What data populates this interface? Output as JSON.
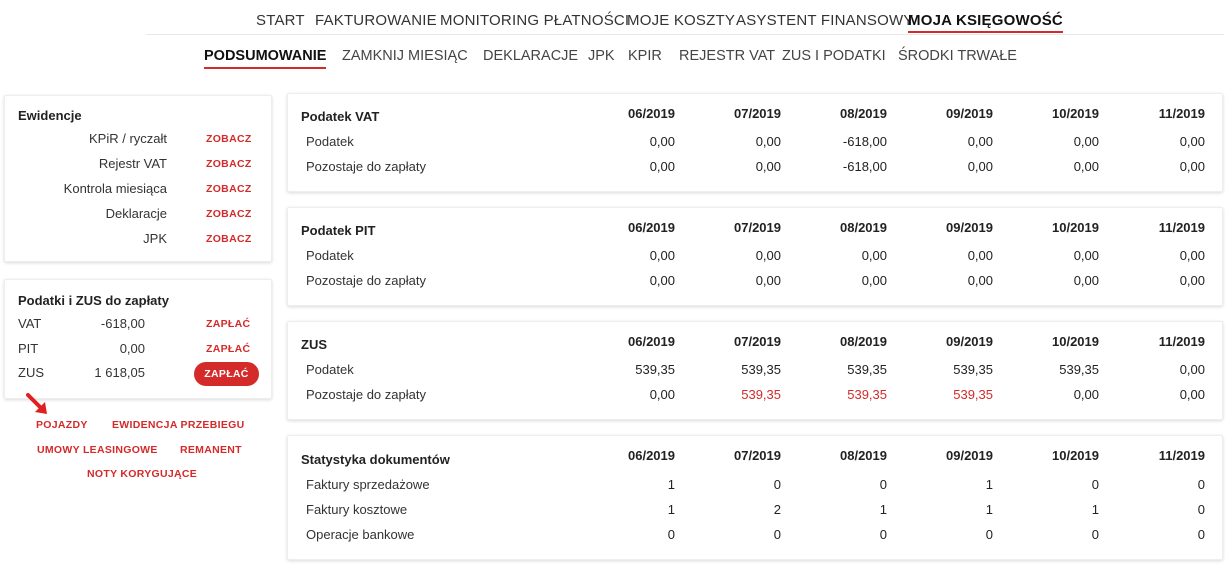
{
  "top_nav": {
    "items": [
      {
        "label": "START",
        "active": false
      },
      {
        "label": "FAKTUROWANIE",
        "active": false
      },
      {
        "label": "MONITORING PŁATNOŚCI",
        "active": false
      },
      {
        "label": "MOJE KOSZTY",
        "active": false
      },
      {
        "label": "ASYSTENT FINANSOWY",
        "active": false
      },
      {
        "label": "MOJA KSIĘGOWOŚĆ",
        "active": true
      }
    ]
  },
  "sub_nav": {
    "items": [
      {
        "label": "PODSUMOWANIE",
        "active": true
      },
      {
        "label": "ZAMKNIJ MIESIĄC",
        "active": false
      },
      {
        "label": "DEKLARACJE",
        "active": false
      },
      {
        "label": "JPK",
        "active": false
      },
      {
        "label": "KPIR",
        "active": false
      },
      {
        "label": "REJESTR VAT",
        "active": false
      },
      {
        "label": "ZUS I PODATKI",
        "active": false
      },
      {
        "label": "ŚRODKI TRWAŁE",
        "active": false
      }
    ]
  },
  "ewidencje": {
    "title": "Ewidencje",
    "rows": [
      {
        "label": "KPiR / ryczałt",
        "link": "ZOBACZ"
      },
      {
        "label": "Rejestr VAT",
        "link": "ZOBACZ"
      },
      {
        "label": "Kontrola miesiąca",
        "link": "ZOBACZ"
      },
      {
        "label": "Deklaracje",
        "link": "ZOBACZ"
      },
      {
        "label": "JPK",
        "link": "ZOBACZ"
      }
    ]
  },
  "podatki_zus": {
    "title": "Podatki i ZUS do zapłaty",
    "rows": [
      {
        "label": "VAT",
        "value": "-618,00",
        "action": "ZAPŁAĆ",
        "style": "link"
      },
      {
        "label": "PIT",
        "value": "0,00",
        "action": "ZAPŁAĆ",
        "style": "link"
      },
      {
        "label": "ZUS",
        "value": "1 618,05",
        "action": "ZAPŁAĆ",
        "style": "button"
      }
    ]
  },
  "extra_links": {
    "pojazdy": "POJAZDY",
    "ewidencja_przebiegu": "EWIDENCJA PRZEBIEGU",
    "umowy_leasingowe": "UMOWY LEASINGOWE",
    "remanent": "REMANENT",
    "noty_korygujace": "NOTY KORYGUJĄCE"
  },
  "colors": {
    "accent": "#d42a2a",
    "text": "#222222",
    "card_border": "#eeeeee"
  },
  "tables": [
    {
      "title": "Podatek VAT",
      "periods": [
        "06/2019",
        "07/2019",
        "08/2019",
        "09/2019",
        "10/2019",
        "11/2019"
      ],
      "rows": [
        {
          "label": "Podatek",
          "values": [
            "0,00",
            "0,00",
            "-618,00",
            "0,00",
            "0,00",
            "0,00"
          ],
          "red": [
            false,
            false,
            false,
            false,
            false,
            false
          ]
        },
        {
          "label": "Pozostaje do zapłaty",
          "values": [
            "0,00",
            "0,00",
            "-618,00",
            "0,00",
            "0,00",
            "0,00"
          ],
          "red": [
            false,
            false,
            false,
            false,
            false,
            false
          ]
        }
      ]
    },
    {
      "title": "Podatek PIT",
      "periods": [
        "06/2019",
        "07/2019",
        "08/2019",
        "09/2019",
        "10/2019",
        "11/2019"
      ],
      "rows": [
        {
          "label": "Podatek",
          "values": [
            "0,00",
            "0,00",
            "0,00",
            "0,00",
            "0,00",
            "0,00"
          ],
          "red": [
            false,
            false,
            false,
            false,
            false,
            false
          ]
        },
        {
          "label": "Pozostaje do zapłaty",
          "values": [
            "0,00",
            "0,00",
            "0,00",
            "0,00",
            "0,00",
            "0,00"
          ],
          "red": [
            false,
            false,
            false,
            false,
            false,
            false
          ]
        }
      ]
    },
    {
      "title": "ZUS",
      "periods": [
        "06/2019",
        "07/2019",
        "08/2019",
        "09/2019",
        "10/2019",
        "11/2019"
      ],
      "rows": [
        {
          "label": "Podatek",
          "values": [
            "539,35",
            "539,35",
            "539,35",
            "539,35",
            "539,35",
            "0,00"
          ],
          "red": [
            false,
            false,
            false,
            false,
            false,
            false
          ]
        },
        {
          "label": "Pozostaje do zapłaty",
          "values": [
            "0,00",
            "539,35",
            "539,35",
            "539,35",
            "0,00",
            "0,00"
          ],
          "red": [
            false,
            true,
            true,
            true,
            false,
            false
          ]
        }
      ]
    },
    {
      "title": "Statystyka dokumentów",
      "periods": [
        "06/2019",
        "07/2019",
        "08/2019",
        "09/2019",
        "10/2019",
        "11/2019"
      ],
      "rows": [
        {
          "label": "Faktury sprzedażowe",
          "values": [
            "1",
            "0",
            "0",
            "1",
            "0",
            "0"
          ],
          "red": [
            false,
            false,
            false,
            false,
            false,
            false
          ]
        },
        {
          "label": "Faktury kosztowe",
          "values": [
            "1",
            "2",
            "1",
            "1",
            "1",
            "0"
          ],
          "red": [
            false,
            false,
            false,
            false,
            false,
            false
          ]
        },
        {
          "label": "Operacje bankowe",
          "values": [
            "0",
            "0",
            "0",
            "0",
            "0",
            "0"
          ],
          "red": [
            false,
            false,
            false,
            false,
            false,
            false
          ]
        }
      ]
    }
  ]
}
